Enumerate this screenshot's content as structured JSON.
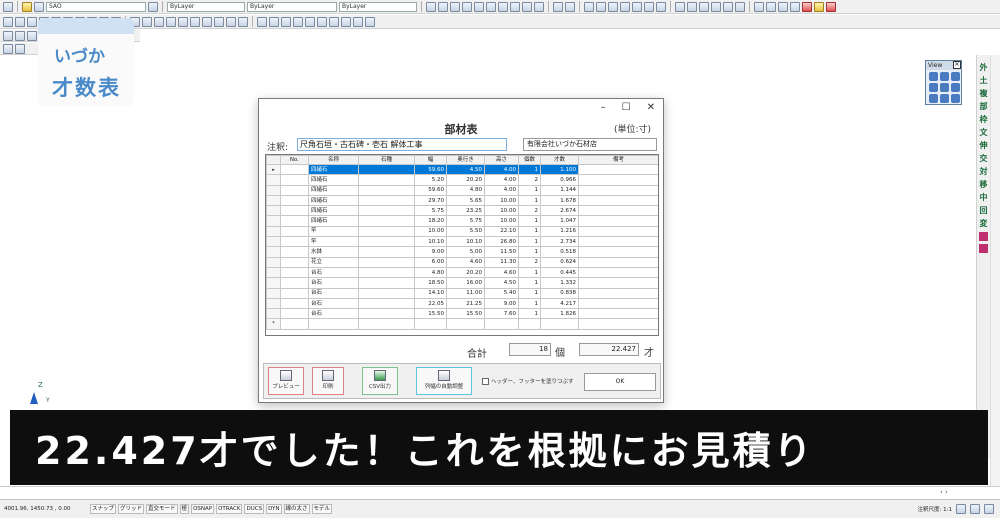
{
  "toolbar": {
    "layer_combo": "SAO",
    "color_combo": "ByLayer",
    "linetype_combo": "ByLayer",
    "lineweight_combo": "ByLayer"
  },
  "logo": {
    "line1": "いづか",
    "line2": "才数表"
  },
  "view_palette": {
    "title": "View"
  },
  "dialog": {
    "title": "部材表",
    "unit_label": "(単位:寸)",
    "window_buttons": {
      "minimize": "–",
      "maximize": "☐",
      "close": "✕"
    },
    "note_label": "注釈:",
    "note_value": "尺角石垣・古石碑・壱石 解体工事",
    "company": "有限会社いづか石材店",
    "columns": [
      "No.",
      "名称",
      "石種",
      "幅",
      "奥行き",
      "高さ",
      "個数",
      "才数",
      "備考"
    ],
    "rows": [
      {
        "name": "四緒石",
        "kind": "",
        "w": "59.60",
        "d": "4.50",
        "h": "4.00",
        "count": "1",
        "sai": "1.100",
        "note": ""
      },
      {
        "name": "四緒石",
        "kind": "",
        "w": "5.20",
        "d": "20.20",
        "h": "4.00",
        "count": "2",
        "sai": "0.966",
        "note": ""
      },
      {
        "name": "四緒石",
        "kind": "",
        "w": "59.60",
        "d": "4.80",
        "h": "4.00",
        "count": "1",
        "sai": "1.144",
        "note": ""
      },
      {
        "name": "四緒石",
        "kind": "",
        "w": "29.70",
        "d": "5.65",
        "h": "10.00",
        "count": "1",
        "sai": "1.678",
        "note": ""
      },
      {
        "name": "四緒石",
        "kind": "",
        "w": "5.75",
        "d": "23.25",
        "h": "10.00",
        "count": "2",
        "sai": "2.674",
        "note": ""
      },
      {
        "name": "四緒石",
        "kind": "",
        "w": "18.20",
        "d": "5.75",
        "h": "10.00",
        "count": "1",
        "sai": "1.047",
        "note": ""
      },
      {
        "name": "竿",
        "kind": "",
        "w": "10.00",
        "d": "5.50",
        "h": "22.10",
        "count": "1",
        "sai": "1.216",
        "note": ""
      },
      {
        "name": "竿",
        "kind": "",
        "w": "10.10",
        "d": "10.10",
        "h": "26.80",
        "count": "1",
        "sai": "2.734",
        "note": ""
      },
      {
        "name": "水鉢",
        "kind": "",
        "w": "9.00",
        "d": "5.00",
        "h": "11.50",
        "count": "1",
        "sai": "0.518",
        "note": ""
      },
      {
        "name": "花立",
        "kind": "",
        "w": "6.00",
        "d": "4.60",
        "h": "11.30",
        "count": "2",
        "sai": "0.624",
        "note": ""
      },
      {
        "name": "台石",
        "kind": "",
        "w": "4.80",
        "d": "20.20",
        "h": "4.60",
        "count": "1",
        "sai": "0.445",
        "note": ""
      },
      {
        "name": "台石",
        "kind": "",
        "w": "18.50",
        "d": "16.00",
        "h": "4.50",
        "count": "1",
        "sai": "1.332",
        "note": ""
      },
      {
        "name": "台石",
        "kind": "",
        "w": "14.10",
        "d": "11.00",
        "h": "5.40",
        "count": "1",
        "sai": "0.838",
        "note": ""
      },
      {
        "name": "台石",
        "kind": "",
        "w": "22.05",
        "d": "21.25",
        "h": "9.00",
        "count": "1",
        "sai": "4.217",
        "note": ""
      },
      {
        "name": "台石",
        "kind": "",
        "w": "15.50",
        "d": "15.50",
        "h": "7.60",
        "count": "1",
        "sai": "1.826",
        "note": ""
      }
    ],
    "new_row_marker": "*",
    "current_row_marker": "▸",
    "total_label": "合計",
    "total_count": "18",
    "count_unit": "個",
    "total_sai": "22.427",
    "sai_unit": "才",
    "buttons": {
      "preview": "プレビュー",
      "print": "印刷",
      "csv": "CSV出力",
      "autofit": "列幅の自動調整",
      "ok": "OK"
    },
    "checkbox_label": "ヘッダー、フッターを塗りつぶす"
  },
  "caption": "22.427才でした！これを根拠にお見積り",
  "statusbar": {
    "coords": "4001.96, 1450.73 , 0.00",
    "toggles": [
      "スナップ",
      "グリッド",
      "直交モード",
      "極",
      "OSNAP",
      "OTRACK",
      "DUCS",
      "DYN",
      "線の太さ",
      "モデル"
    ],
    "annotation_scale": "注釈尺度: 1:1"
  },
  "colors": {
    "selection": "#0078d7",
    "banner_bg": "#0e0e0e",
    "logo_text": "#4a8ac8"
  }
}
